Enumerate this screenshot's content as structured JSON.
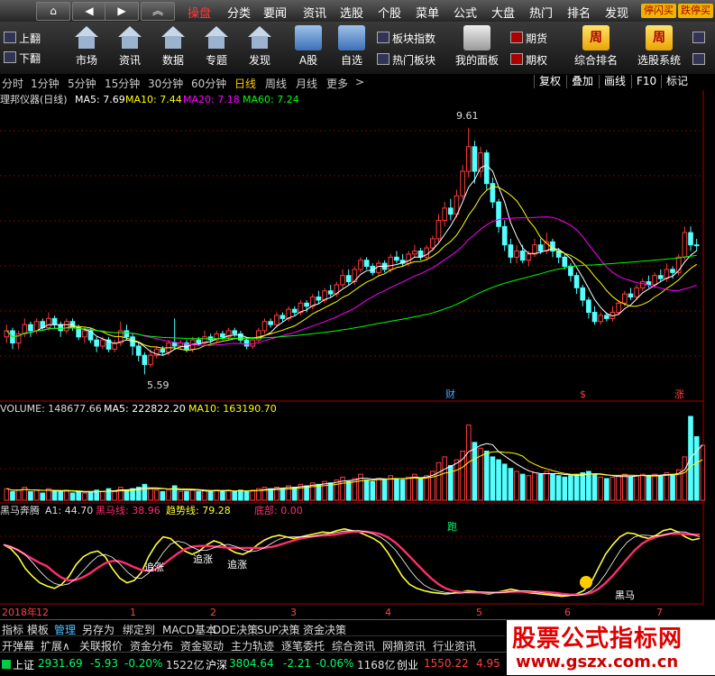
{
  "menubar": {
    "nav": [
      "⌂",
      "◀",
      "▶",
      "︽"
    ],
    "items": [
      "操盘",
      "分类",
      "要闻",
      "资讯",
      "选股",
      "个股",
      "菜单",
      "公式",
      "大盘",
      "热门",
      "排名",
      "发现"
    ],
    "pills": [
      "停闪买",
      "跌停买"
    ]
  },
  "toolbar": {
    "page_up": "上翻",
    "page_down": "下翻",
    "tools": [
      "市场",
      "资讯",
      "数据",
      "专题",
      "发现"
    ],
    "a_stock": "A股",
    "self_select": "自选",
    "board_index": "板块指数",
    "hot_board": "热门板块",
    "my_panel": "我的面板",
    "futures": "期货",
    "options": "期权",
    "rank": "综合排名",
    "rank_icon_char": "周",
    "select_system": "选股系统",
    "select_icon_char": "周"
  },
  "periods": {
    "items": [
      "分时",
      "1分钟",
      "5分钟",
      "15分钟",
      "30分钟",
      "60分钟",
      "日线",
      "周线",
      "月线",
      "更多"
    ],
    "more_arrow": ">",
    "selected": "日线",
    "right_tabs": [
      "复权",
      "叠加",
      "画线",
      "F10",
      "标记"
    ]
  },
  "main_panel": {
    "title": "理邦仪器(日线)",
    "ma5": "MA5: 7.69",
    "ma10": "MA10: 7.44",
    "ma20": "MA20: 7.18",
    "ma60": "MA60: 7.24",
    "high_label": "9.61",
    "low_label": "5.59",
    "markers": [
      "财",
      "$",
      "涨"
    ]
  },
  "volume_panel": {
    "vol": "VOLUME: 148677.66",
    "ma5": "MA5: 222822.20",
    "ma10": "MA10: 163190.70"
  },
  "indicator_panel": {
    "name": "黑马奔腾",
    "a1": "A1: 44.70",
    "heima": "黑马线: 38.96",
    "trend": "趋势线: 79.28",
    "bottom": "底部: 0.00",
    "annotations": [
      "追涨",
      "追涨",
      "追涨",
      "跑",
      "黑马"
    ]
  },
  "date_axis": [
    "2018年",
    "12",
    "1",
    "2",
    "3",
    "4",
    "5",
    "6",
    "7"
  ],
  "function_tabs": [
    "指标",
    "模板",
    "管理",
    "另存为",
    "绑定到",
    "MACD基本",
    "DDE决策",
    "SUP决策",
    "资金决策"
  ],
  "function_tab_selected": "管理",
  "sub_tabs": [
    "开弹幕",
    "扩展∧",
    "关联报价",
    "资金分布",
    "资金驱动",
    "主力轨迹",
    "逐笔委托",
    "综合资讯",
    "网摘资讯",
    "行业资讯"
  ],
  "index_bar": {
    "sh_name": "上证",
    "sh_value": "2931.69",
    "sh_change": "-5.93",
    "sh_pct": "-0.20%",
    "sh_amount": "1522亿",
    "hs_name": "沪深",
    "hs_value": "3804.64",
    "hs_change": "-2.21",
    "hs_pct": "-0.06%",
    "hs_amount": "1168亿",
    "cy_name": "创业",
    "cy_value": "1550.22",
    "cy_change": "4.95"
  },
  "watermark": {
    "line1": "股票公式指标网",
    "line2": "www.gszx.com.cn"
  },
  "colors": {
    "up": "#ff3c3c",
    "down": "#54ffff",
    "ma5": "#ffffff",
    "ma10": "#ffff00",
    "ma20": "#ff00ff",
    "ma60": "#00ff00",
    "heima": "#ff2e6d",
    "trend": "#ffff33"
  },
  "chart_data": {
    "type": "candlestick",
    "y_range": [
      5.3,
      9.9
    ],
    "candles": [
      [
        6.2,
        6.3,
        6.4,
        6.1
      ],
      [
        6.3,
        6.1,
        6.35,
        6.0
      ],
      [
        6.1,
        6.25,
        6.3,
        6.0
      ],
      [
        6.25,
        6.4,
        6.5,
        6.2
      ],
      [
        6.4,
        6.3,
        6.45,
        6.2
      ],
      [
        6.3,
        6.45,
        6.5,
        6.25
      ],
      [
        6.45,
        6.35,
        6.5,
        6.3
      ],
      [
        6.35,
        6.5,
        6.6,
        6.3
      ],
      [
        6.5,
        6.4,
        6.55,
        6.35
      ],
      [
        6.4,
        6.3,
        6.45,
        6.2
      ],
      [
        6.3,
        6.45,
        6.5,
        6.25
      ],
      [
        6.45,
        6.35,
        6.5,
        6.3
      ],
      [
        6.35,
        6.2,
        6.4,
        6.15
      ],
      [
        6.2,
        6.3,
        6.35,
        6.1
      ],
      [
        6.3,
        6.15,
        6.35,
        6.1
      ],
      [
        6.15,
        6.05,
        6.2,
        5.95
      ],
      [
        6.05,
        6.15,
        6.2,
        6.0
      ],
      [
        6.15,
        6.0,
        6.2,
        5.95
      ],
      [
        6.0,
        6.1,
        6.15,
        5.95
      ],
      [
        6.1,
        6.3,
        6.45,
        6.05
      ],
      [
        6.3,
        6.2,
        6.4,
        6.15
      ],
      [
        6.2,
        6.05,
        6.25,
        5.9
      ],
      [
        6.05,
        5.9,
        6.1,
        5.8
      ],
      [
        5.9,
        5.75,
        5.95,
        5.59
      ],
      [
        5.75,
        5.9,
        6.0,
        5.7
      ],
      [
        5.9,
        6.0,
        6.05,
        5.85
      ],
      [
        6.0,
        5.95,
        6.05,
        5.9
      ],
      [
        5.95,
        6.1,
        6.15,
        5.9
      ],
      [
        6.1,
        6.05,
        6.5,
        6.0
      ],
      [
        6.05,
        6.1,
        6.15,
        6.0
      ],
      [
        6.1,
        6.0,
        6.15,
        5.95
      ],
      [
        6.0,
        6.15,
        6.2,
        5.95
      ],
      [
        6.15,
        6.1,
        6.2,
        6.05
      ],
      [
        6.1,
        6.2,
        6.3,
        6.05
      ],
      [
        6.2,
        6.15,
        6.25,
        6.1
      ],
      [
        6.15,
        6.25,
        6.3,
        6.1
      ],
      [
        6.25,
        6.2,
        6.3,
        6.15
      ],
      [
        6.2,
        6.3,
        6.35,
        6.15
      ],
      [
        6.3,
        6.25,
        6.35,
        6.2
      ],
      [
        6.25,
        6.15,
        6.3,
        6.1
      ],
      [
        6.15,
        6.05,
        6.2,
        6.0
      ],
      [
        6.05,
        6.15,
        6.2,
        6.0
      ],
      [
        6.15,
        6.3,
        6.35,
        6.1
      ],
      [
        6.3,
        6.45,
        6.5,
        6.25
      ],
      [
        6.45,
        6.4,
        6.5,
        6.35
      ],
      [
        6.4,
        6.55,
        6.6,
        6.35
      ],
      [
        6.55,
        6.5,
        6.6,
        6.45
      ],
      [
        6.5,
        6.65,
        6.7,
        6.45
      ],
      [
        6.65,
        6.6,
        6.7,
        6.55
      ],
      [
        6.6,
        6.75,
        6.8,
        6.55
      ],
      [
        6.75,
        6.7,
        6.8,
        6.6
      ],
      [
        6.7,
        6.85,
        6.9,
        6.65
      ],
      [
        6.85,
        6.8,
        6.95,
        6.75
      ],
      [
        6.8,
        6.95,
        7.0,
        6.75
      ],
      [
        6.95,
        6.9,
        7.05,
        6.85
      ],
      [
        6.9,
        7.05,
        7.1,
        6.85
      ],
      [
        7.05,
        7.2,
        7.3,
        7.0
      ],
      [
        7.2,
        7.1,
        7.3,
        7.05
      ],
      [
        7.1,
        7.3,
        7.35,
        7.05
      ],
      [
        7.3,
        7.45,
        7.5,
        7.25
      ],
      [
        7.45,
        7.35,
        7.5,
        7.3
      ],
      [
        7.35,
        7.25,
        7.4,
        7.2
      ],
      [
        7.25,
        7.4,
        7.45,
        7.2
      ],
      [
        7.4,
        7.3,
        7.45,
        7.25
      ],
      [
        7.3,
        7.5,
        7.55,
        7.25
      ],
      [
        7.5,
        7.45,
        7.6,
        7.4
      ],
      [
        7.45,
        7.4,
        7.55,
        7.35
      ],
      [
        7.4,
        7.55,
        7.6,
        7.35
      ],
      [
        7.55,
        7.6,
        7.7,
        7.5
      ],
      [
        7.6,
        7.5,
        7.65,
        7.45
      ],
      [
        7.5,
        7.65,
        7.7,
        7.45
      ],
      [
        7.65,
        7.8,
        7.85,
        7.6
      ],
      [
        7.8,
        8.1,
        8.2,
        7.75
      ],
      [
        8.1,
        8.3,
        8.4,
        8.0
      ],
      [
        8.3,
        8.2,
        8.45,
        8.1
      ],
      [
        8.2,
        8.5,
        8.6,
        8.15
      ],
      [
        8.5,
        8.9,
        9.0,
        8.45
      ],
      [
        8.9,
        9.3,
        9.61,
        8.8
      ],
      [
        9.3,
        8.9,
        9.4,
        8.7
      ],
      [
        8.9,
        9.2,
        9.3,
        8.8
      ],
      [
        9.2,
        8.7,
        9.25,
        8.6
      ],
      [
        8.7,
        8.4,
        8.8,
        8.3
      ],
      [
        8.4,
        8.0,
        8.45,
        7.9
      ],
      [
        8.0,
        7.7,
        8.1,
        7.6
      ],
      [
        7.7,
        7.5,
        7.8,
        7.4
      ],
      [
        7.5,
        7.6,
        7.7,
        7.4
      ],
      [
        7.6,
        7.45,
        7.7,
        7.4
      ],
      [
        7.45,
        7.55,
        7.6,
        7.35
      ],
      [
        7.55,
        7.7,
        7.8,
        7.5
      ],
      [
        7.7,
        7.6,
        7.8,
        7.55
      ],
      [
        7.6,
        7.75,
        7.9,
        7.55
      ],
      [
        7.75,
        7.6,
        7.8,
        7.5
      ],
      [
        7.6,
        7.5,
        7.65,
        7.4
      ],
      [
        7.5,
        7.35,
        7.55,
        7.3
      ],
      [
        7.35,
        7.2,
        7.4,
        7.1
      ],
      [
        7.2,
        7.0,
        7.25,
        6.9
      ],
      [
        7.0,
        6.8,
        7.05,
        6.7
      ],
      [
        6.8,
        6.6,
        6.85,
        6.5
      ],
      [
        6.6,
        6.45,
        6.7,
        6.4
      ],
      [
        6.45,
        6.55,
        6.6,
        6.4
      ],
      [
        6.55,
        6.5,
        6.6,
        6.45
      ],
      [
        6.5,
        6.6,
        6.7,
        6.45
      ],
      [
        6.6,
        6.75,
        6.8,
        6.55
      ],
      [
        6.75,
        6.9,
        6.95,
        6.7
      ],
      [
        6.9,
        6.85,
        7.0,
        6.8
      ],
      [
        6.85,
        7.0,
        7.05,
        6.8
      ],
      [
        7.0,
        7.1,
        7.15,
        6.95
      ],
      [
        7.1,
        7.05,
        7.2,
        7.0
      ],
      [
        7.05,
        7.2,
        7.25,
        7.0
      ],
      [
        7.2,
        7.15,
        7.3,
        7.1
      ],
      [
        7.15,
        7.3,
        7.4,
        7.1
      ],
      [
        7.3,
        7.25,
        7.35,
        7.15
      ],
      [
        7.25,
        7.5,
        7.55,
        7.2
      ],
      [
        7.5,
        7.9,
        8.0,
        7.45
      ],
      [
        7.9,
        7.7,
        8.0,
        7.6
      ],
      [
        7.7,
        7.69,
        7.8,
        7.6
      ]
    ],
    "volumes": [
      8,
      6,
      7,
      9,
      6,
      7,
      5,
      8,
      6,
      6,
      7,
      5,
      6,
      5,
      6,
      7,
      6,
      8,
      6,
      9,
      7,
      8,
      9,
      11,
      8,
      7,
      6,
      7,
      10,
      6,
      6,
      7,
      6,
      7,
      6,
      7,
      6,
      7,
      6,
      7,
      6,
      7,
      8,
      9,
      8,
      9,
      8,
      10,
      9,
      11,
      10,
      12,
      11,
      13,
      12,
      14,
      16,
      13,
      15,
      18,
      14,
      13,
      15,
      14,
      17,
      15,
      14,
      16,
      18,
      15,
      17,
      20,
      26,
      30,
      24,
      28,
      34,
      52,
      40,
      36,
      34,
      30,
      28,
      25,
      22,
      20,
      18,
      17,
      19,
      18,
      20,
      18,
      17,
      16,
      17,
      18,
      19,
      20,
      18,
      16,
      15,
      16,
      17,
      18,
      16,
      17,
      18,
      17,
      18,
      17,
      19,
      18,
      21,
      30,
      58,
      44,
      38
    ],
    "indicator": {
      "trend": [
        70,
        65,
        55,
        40,
        30,
        22,
        18,
        15,
        20,
        30,
        45,
        55,
        60,
        62,
        55,
        40,
        28,
        22,
        25,
        35,
        55,
        70,
        80,
        78,
        70,
        62,
        58,
        62,
        70,
        75,
        72,
        65,
        60,
        58,
        62,
        70,
        76,
        80,
        82,
        80,
        78,
        80,
        82,
        84,
        86,
        85,
        88,
        90,
        88,
        86,
        82,
        78,
        72,
        60,
        45,
        30,
        20,
        15,
        12,
        10,
        9,
        8,
        9,
        10,
        12,
        11,
        9,
        8,
        10,
        12,
        14,
        12,
        10,
        9,
        8,
        7,
        6,
        5,
        6,
        8,
        12,
        22,
        40,
        58,
        70,
        80,
        85,
        84,
        80,
        78,
        82,
        88,
        90,
        86,
        80,
        76,
        78
      ]
    }
  }
}
